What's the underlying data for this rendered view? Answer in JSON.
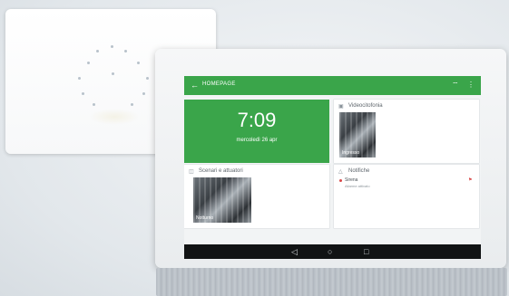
{
  "app": {
    "title": "HOMEPAGE",
    "back_icon": "arrow-left-icon",
    "actions": [
      "wifi-icon",
      "more-icon"
    ]
  },
  "clock": {
    "time": "7:09",
    "date": "mercoledì 26 apr"
  },
  "cards": {
    "video": {
      "title": "Videocitofonia",
      "thumb_label": "Ingresso"
    },
    "scenes": {
      "title": "Scenari e attuatori",
      "thumb_label": "Notturno"
    },
    "alerts": {
      "title": "Notifiche",
      "item_title": "Sirena",
      "item_sub": "Allarme attivato"
    }
  },
  "nav": {
    "back": "◁",
    "home": "○",
    "recents": "□"
  },
  "colors": {
    "accent": "#3aa54a",
    "alert": "#d94848",
    "navbar": "#111314"
  }
}
